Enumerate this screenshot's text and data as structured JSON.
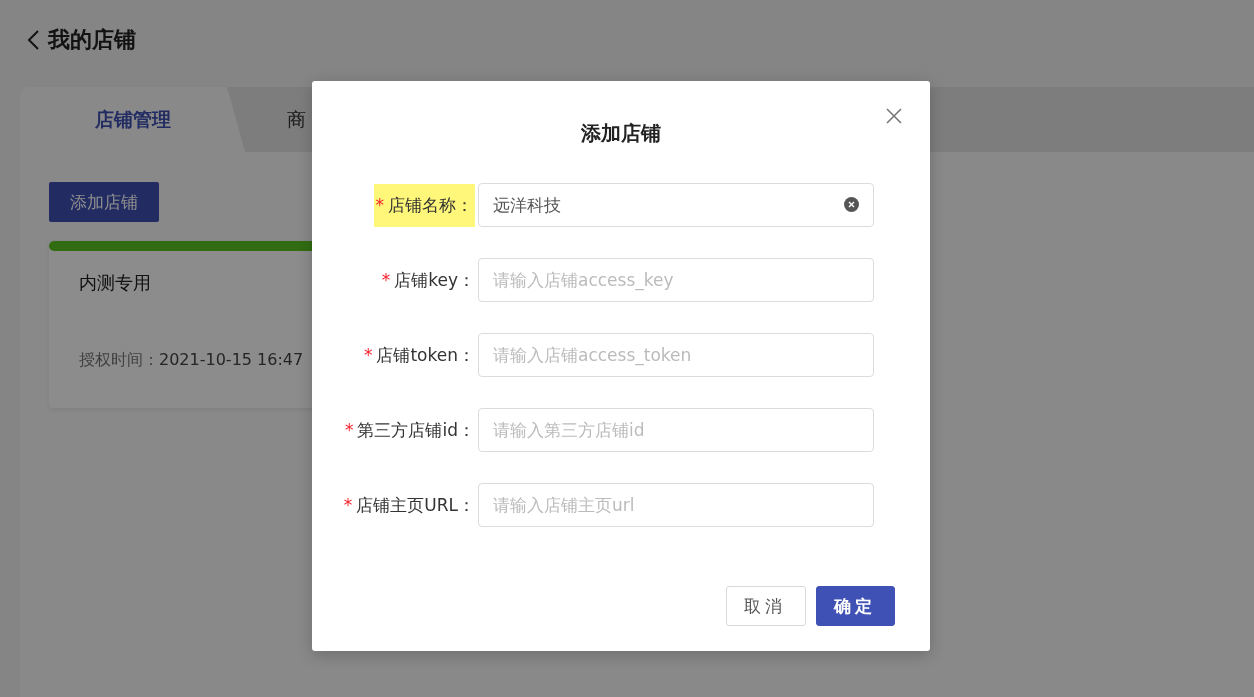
{
  "header": {
    "title": "我的店铺"
  },
  "tabs": [
    {
      "label": "店铺管理",
      "selected": true
    },
    {
      "label": "商",
      "selected": false
    }
  ],
  "add_button": "添加店铺",
  "stores": [
    {
      "name": "内测专用",
      "auth_label": "授权时间：",
      "auth_time": "2021-10-15 16:47"
    }
  ],
  "dialog": {
    "title": "添加店铺",
    "fields": [
      {
        "required_mark": "*",
        "label": "店铺名称：",
        "highlighted": true,
        "value": "远洋科技",
        "clearable": true
      },
      {
        "required_mark": "*",
        "label": "店铺key：",
        "highlighted": false,
        "placeholder": "请输入店铺access_key",
        "clearable": false
      },
      {
        "required_mark": "*",
        "label": "店铺token：",
        "highlighted": false,
        "placeholder": "请输入店铺access_token",
        "clearable": false
      },
      {
        "required_mark": "*",
        "label": "第三方店铺id：",
        "highlighted": false,
        "placeholder": "请输入第三方店铺id",
        "clearable": false
      },
      {
        "required_mark": "*",
        "label": "店铺主页URL：",
        "highlighted": false,
        "placeholder": "请输入店铺主页url",
        "clearable": false
      }
    ],
    "buttons": [
      {
        "label": "取消",
        "kind": "default"
      },
      {
        "label": "确定",
        "kind": "primary"
      }
    ]
  }
}
